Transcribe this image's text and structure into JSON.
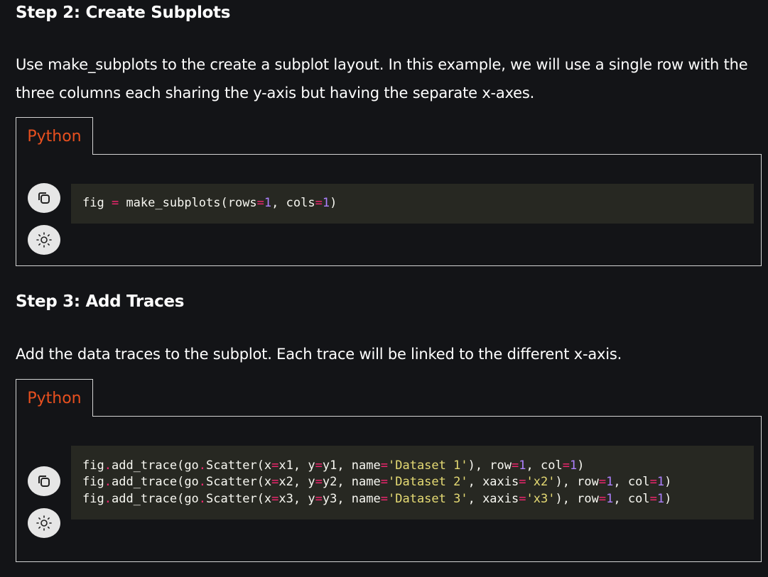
{
  "step2": {
    "heading": "Step 2: Create Subplots",
    "description": "Use make_subplots to the create a subplot layout. In this example, we will use a single row with the three columns each sharing the y-axis but having the separate x-axes.",
    "tab_label": "Python",
    "code": {
      "line1": {
        "var": "fig",
        "eq": " = ",
        "fn": "make_subplots(rows",
        "eq2": "=",
        "n1": "1",
        "mid": ", cols",
        "eq3": "=",
        "n2": "1",
        "end": ")"
      }
    }
  },
  "step3": {
    "heading": "Step 3: Add Traces",
    "description": "Add the data traces to the subplot. Each trace will be linked to the different x-axis.",
    "tab_label": "Python",
    "code": {
      "lines": [
        {
          "a": "fig",
          "b": "add_trace(go",
          "c": "Scatter(x",
          "d": "x1, y",
          "e": "y1, name",
          "s1": "'Dataset 1'",
          "f": "), row",
          "n1": "1",
          "g": ", col",
          "n2": "1",
          "h": ")"
        },
        {
          "a": "fig",
          "b": "add_trace(go",
          "c": "Scatter(x",
          "d": "x2, y",
          "e": "y2, name",
          "s1": "'Dataset 2'",
          "x": ", xaxis",
          "s2": "'x2'",
          "f": "), row",
          "n1": "1",
          "g": ", col",
          "n2": "1",
          "h": ")"
        },
        {
          "a": "fig",
          "b": "add_trace(go",
          "c": "Scatter(x",
          "d": "x3, y",
          "e": "y3, name",
          "s1": "'Dataset 3'",
          "x": ", xaxis",
          "s2": "'x3'",
          "f": "), row",
          "n1": "1",
          "g": ", col",
          "n2": "1",
          "h": ")"
        }
      ]
    }
  },
  "icons": {
    "copy": "copy-icon",
    "theme": "sun-icon"
  },
  "colors": {
    "background": "#131417",
    "tab_text": "#e8501f",
    "code_bg": "#272822",
    "operator": "#f92672",
    "number": "#ae81ff",
    "string": "#e6db74"
  }
}
